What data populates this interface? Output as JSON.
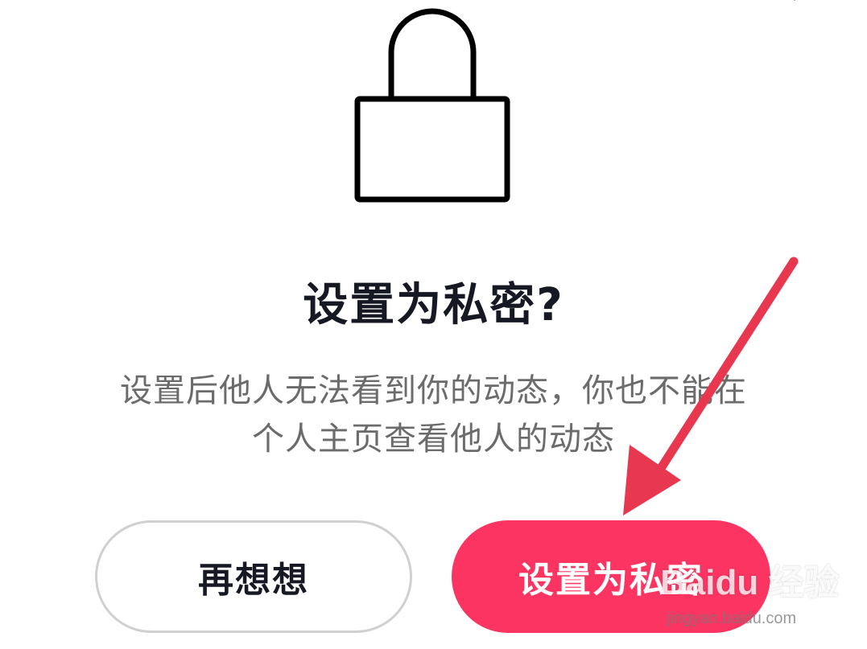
{
  "dialog": {
    "title": "设置为私密?",
    "description_line1": "设置后他人无法看到你的动态，你也不能在",
    "description_line2": "个人主页查看他人的动态",
    "cancel_label": "再想想",
    "confirm_label": "设置为私密",
    "icon": "lock-icon"
  },
  "watermark": {
    "logo_text": "Baidu 经验",
    "url": "jingyan.baidu.com"
  },
  "colors": {
    "confirm_button": "#fb3461",
    "title_text": "#161823",
    "description_text": "#6b6b6b",
    "annotation_arrow": "#e8384f"
  }
}
